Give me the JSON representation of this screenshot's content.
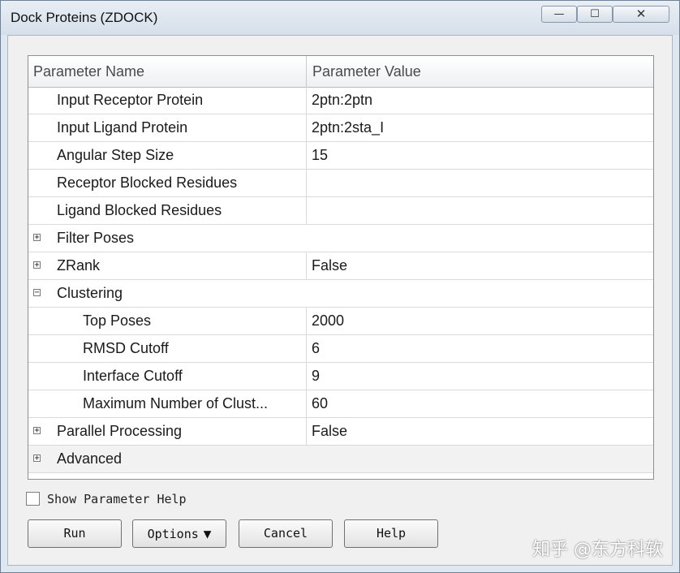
{
  "window": {
    "title": "Dock Proteins (ZDOCK)",
    "controls": {
      "minimize": "—",
      "maximize": "☐",
      "close": "✕"
    }
  },
  "grid": {
    "headers": {
      "name": "Parameter Name",
      "value": "Parameter Value"
    },
    "rows": [
      {
        "name": "Input Receptor Protein",
        "value": "2ptn:2ptn"
      },
      {
        "name": "Input Ligand Protein",
        "value": "2ptn:2sta_I"
      },
      {
        "name": "Angular Step Size",
        "value": "15"
      },
      {
        "name": "Receptor Blocked Residues",
        "value": ""
      },
      {
        "name": "Ligand Blocked Residues",
        "value": ""
      },
      {
        "name": "Filter Poses",
        "value": "",
        "expander": "+"
      },
      {
        "name": "ZRank",
        "value": "False",
        "expander": "+"
      },
      {
        "name": "Clustering",
        "value": "",
        "expander": "−"
      },
      {
        "name": "Top Poses",
        "value": "2000"
      },
      {
        "name": "RMSD Cutoff",
        "value": "6"
      },
      {
        "name": "Interface Cutoff",
        "value": "9"
      },
      {
        "name": "Maximum Number of Clust...",
        "value": "60"
      },
      {
        "name": "Parallel Processing",
        "value": "False",
        "expander": "+"
      },
      {
        "name": "Advanced",
        "value": "",
        "expander": "+"
      }
    ]
  },
  "help_checkbox": {
    "label": "Show Parameter Help",
    "checked": false
  },
  "buttons": {
    "run": "Run",
    "options": "Options",
    "options_caret": "▼",
    "cancel": "Cancel",
    "help": "Help"
  },
  "watermark": "知乎 @东方科软"
}
